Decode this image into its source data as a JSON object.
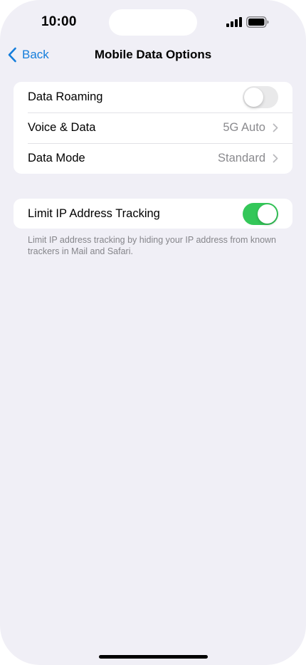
{
  "status_bar": {
    "time": "10:00",
    "icons": [
      "signal-icon",
      "battery-icon"
    ]
  },
  "nav": {
    "back_label": "Back",
    "title": "Mobile Data Options",
    "accent_color": "#147ddb"
  },
  "group1": {
    "rows": [
      {
        "label": "Data Roaming",
        "control": "toggle",
        "on": false
      },
      {
        "label": "Voice & Data",
        "value": "5G Auto",
        "control": "chevron"
      },
      {
        "label": "Data Mode",
        "value": "Standard",
        "control": "chevron"
      }
    ]
  },
  "group2": {
    "rows": [
      {
        "label": "Limit IP Address Tracking",
        "control": "toggle",
        "on": true
      }
    ],
    "footnote": "Limit IP address tracking by hiding your IP address from known trackers in Mail and Safari."
  },
  "colors": {
    "background": "#f0eff6",
    "toggle_on": "#34c759",
    "toggle_off": "#e9e9ea",
    "secondary_text": "#8a8a8e"
  }
}
